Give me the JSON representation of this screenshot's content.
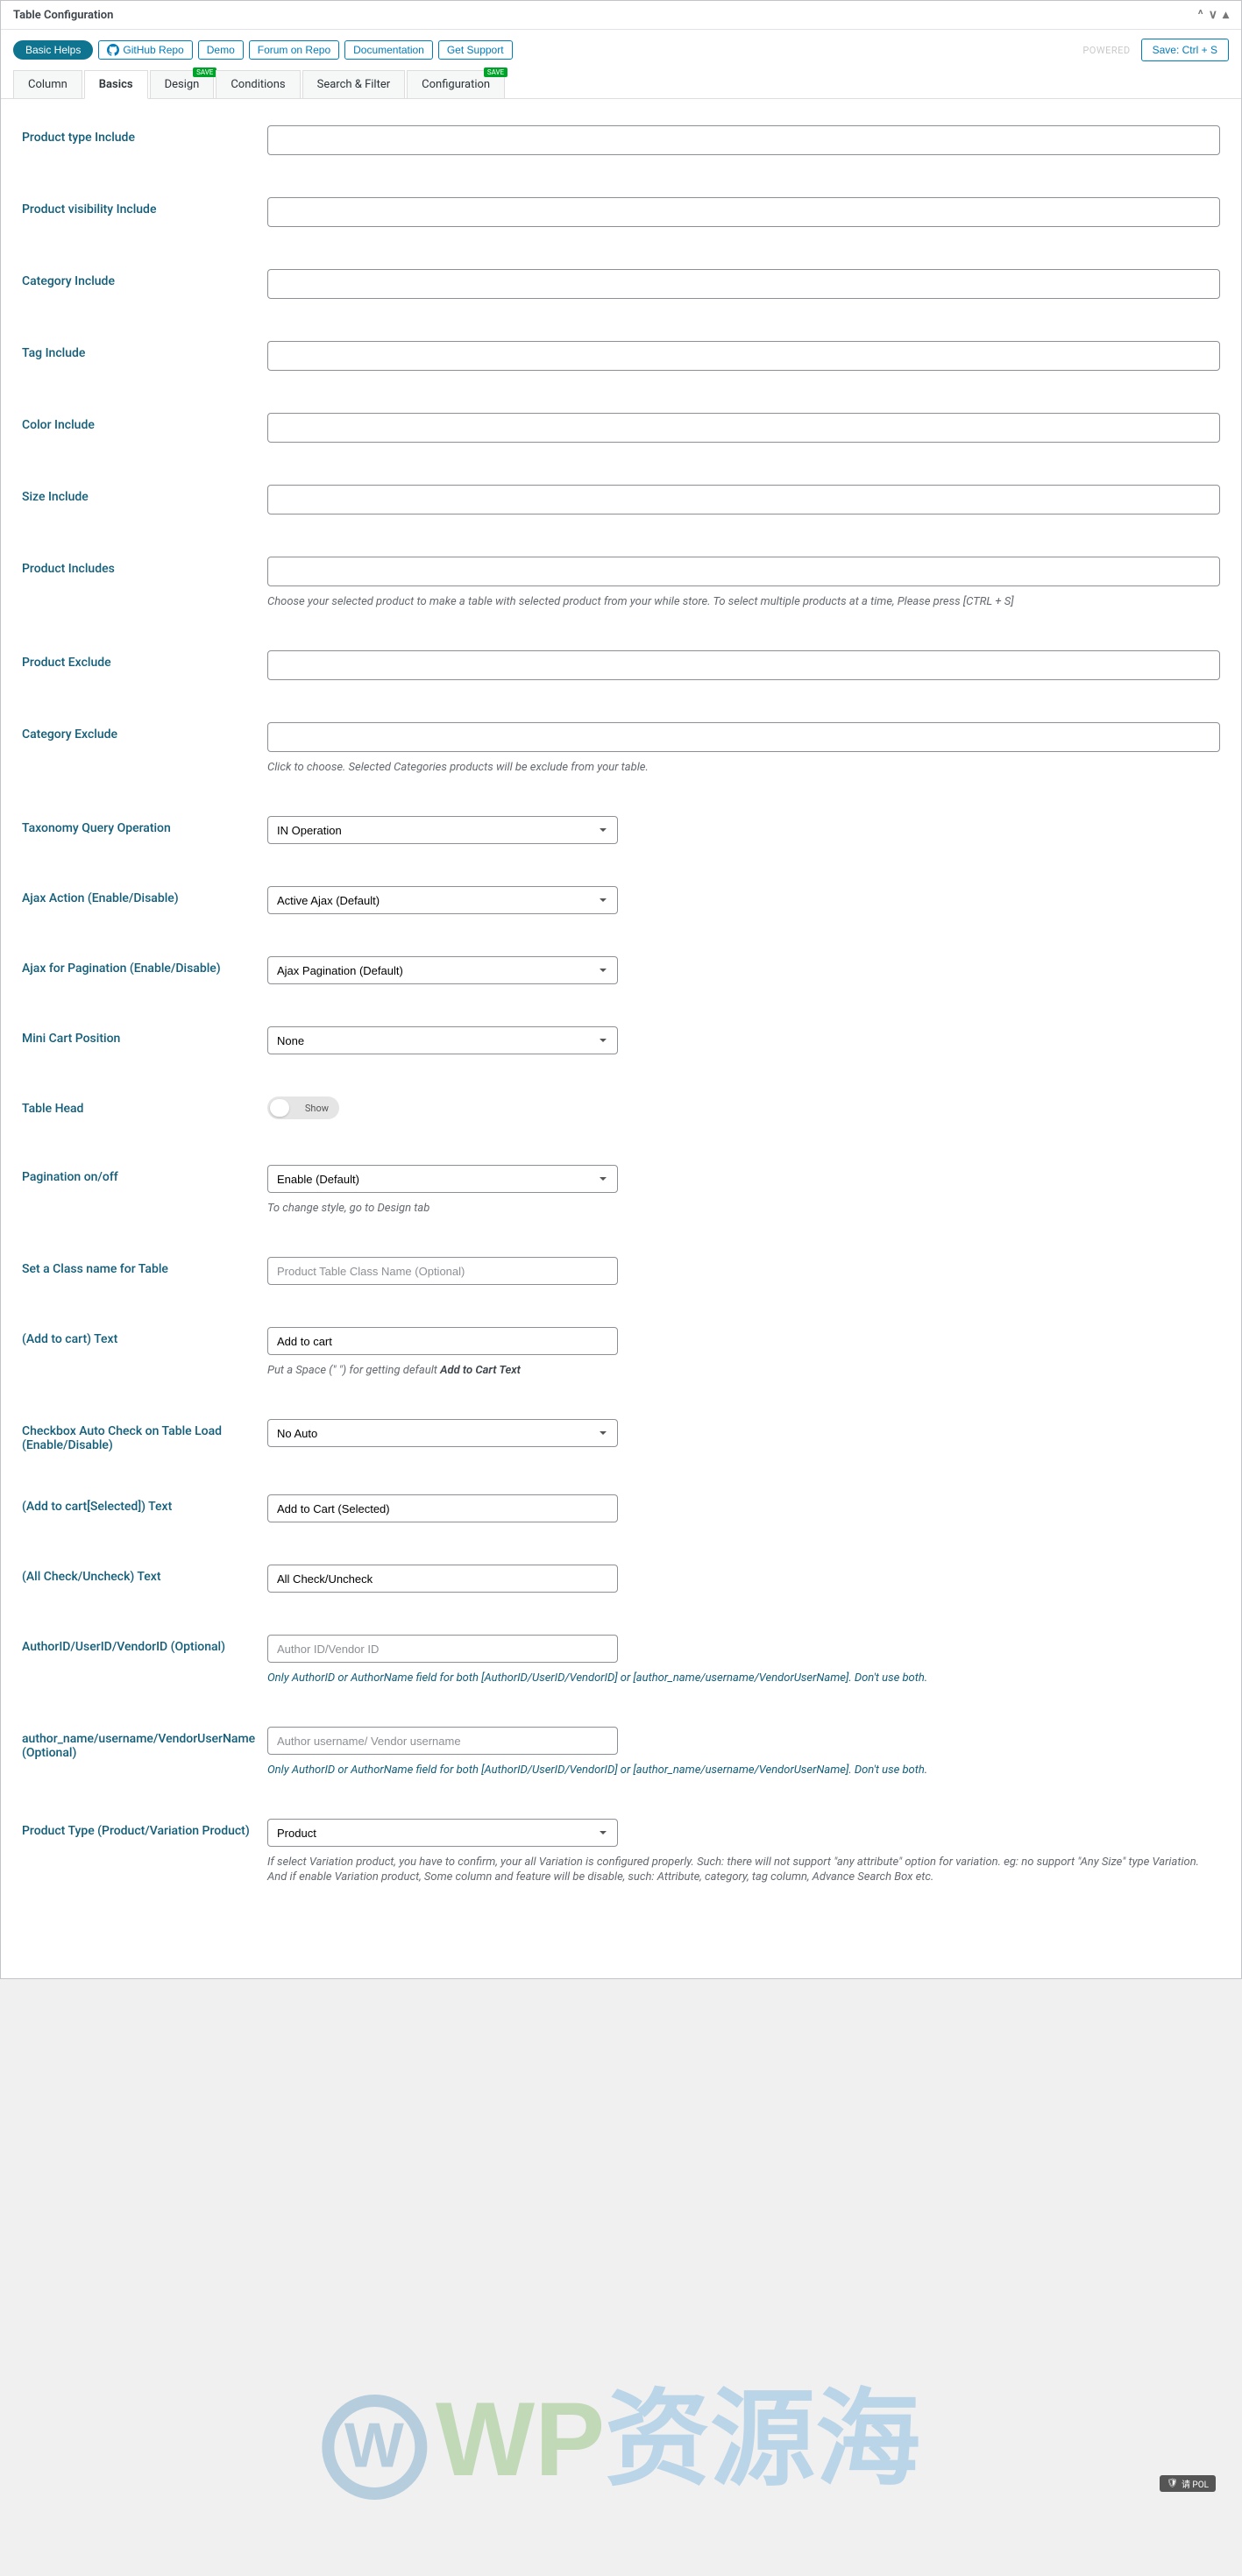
{
  "panel": {
    "title": "Table Configuration"
  },
  "toolbar": {
    "basic_helps": "Basic Helps",
    "github": "GitHub Repo",
    "demo": "Demo",
    "forum": "Forum on Repo",
    "docs": "Documentation",
    "support": "Get Support",
    "faded": "POWERED",
    "save": "Save: Ctrl + S"
  },
  "tabs": {
    "column": "Column",
    "basics": "Basics",
    "design": "Design",
    "conditions": "Conditions",
    "search_filter": "Search & Filter",
    "configuration": "Configuration",
    "badge": "SAVE"
  },
  "fields": {
    "product_type_include": {
      "label": "Product type Include"
    },
    "product_visibility_include": {
      "label": "Product visibility Include"
    },
    "category_include": {
      "label": "Category Include"
    },
    "tag_include": {
      "label": "Tag Include"
    },
    "color_include": {
      "label": "Color Include"
    },
    "size_include": {
      "label": "Size Include"
    },
    "product_includes": {
      "label": "Product Includes",
      "helper": "Choose your selected product to make a table with selected product from your while store. To select multiple products at a time, Please press [CTRL + S]"
    },
    "product_exclude": {
      "label": "Product Exclude"
    },
    "category_exclude": {
      "label": "Category Exclude",
      "helper": "Click to choose. Selected Categories products will be exclude from your table."
    },
    "taxonomy_query": {
      "label": "Taxonomy Query Operation",
      "value": "IN Operation"
    },
    "ajax_action": {
      "label": "Ajax Action (Enable/Disable)",
      "value": "Active Ajax (Default)"
    },
    "ajax_pagination": {
      "label": "Ajax for Pagination (Enable/Disable)",
      "value": "Ajax Pagination (Default)"
    },
    "mini_cart": {
      "label": "Mini Cart Position",
      "value": "None"
    },
    "table_head": {
      "label": "Table Head",
      "toggle": "Show"
    },
    "pagination": {
      "label": "Pagination on/off",
      "value": "Enable (Default)",
      "helper": "To change style, go to Design tab"
    },
    "class_name": {
      "label": "Set a Class name for Table",
      "placeholder": "Product Table Class Name (Optional)"
    },
    "add_to_cart": {
      "label": "(Add to cart) Text",
      "value": "Add to cart",
      "helper_pre": "Put a Space (\" \") for getting default ",
      "helper_bold": "Add to Cart Text"
    },
    "checkbox_auto": {
      "label": "Checkbox Auto Check on Table Load (Enable/Disable)",
      "value": "No Auto"
    },
    "add_to_cart_selected": {
      "label": "(Add to cart[Selected]) Text",
      "value": "Add to Cart (Selected)"
    },
    "all_check": {
      "label": "(All Check/Uncheck) Text",
      "value": "All Check/Uncheck"
    },
    "author_id": {
      "label": "AuthorID/UserID/VendorID (Optional)",
      "placeholder": "Author ID/Vendor ID",
      "helper": "Only AuthorID or AuthorName field for both [AuthorID/UserID/VendorID] or [author_name/username/VendorUserName]. Don't use both."
    },
    "author_name": {
      "label": "author_name/username/VendorUserName (Optional)",
      "placeholder": "Author username/ Vendor username",
      "helper": "Only AuthorID or AuthorName field for both [AuthorID/UserID/VendorID] or [author_name/username/VendorUserName]. Don't use both."
    },
    "product_type": {
      "label": "Product Type (Product/Variation Product)",
      "value": "Product",
      "helper1": "If select Variation product, you have to confirm, your all Variation is configured properly. Such: there will not support \"any attribute\" option for variation. eg: no support \"Any Size\" type Variation.",
      "helper2": "And if enable Variation product, Some column and feature will be disable, such: Attribute, category, tag column, Advance Search Box etc."
    }
  },
  "watermark": {
    "text": "WP资源海"
  },
  "polbadge": "请 POL"
}
